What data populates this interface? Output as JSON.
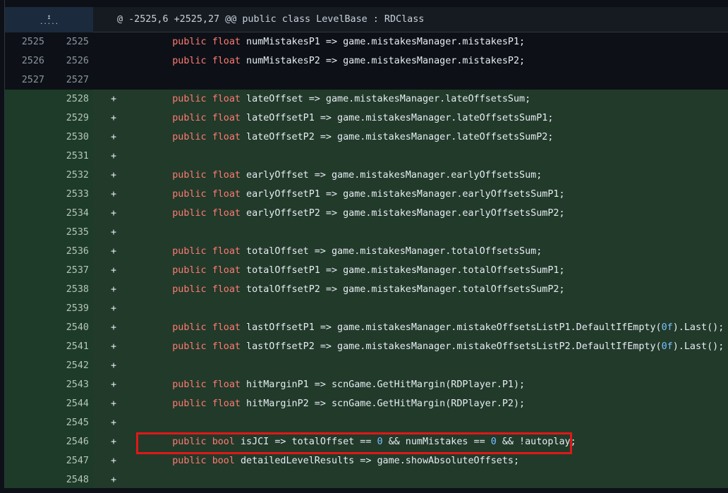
{
  "hunk": {
    "header": "@ -2525,6 +2525,27 @@ public class LevelBase : RDClass",
    "expand_icon": "expand-up-icon"
  },
  "lines": [
    {
      "type": "ctx",
      "old": "2525",
      "new": "2525",
      "marker": "",
      "tokens": [
        {
          "t": "    "
        },
        {
          "t": "public",
          "c": "kw"
        },
        {
          "t": " "
        },
        {
          "t": "float",
          "c": "kw"
        },
        {
          "t": " numMistakesP1 => game.mistakesManager.mistakesP1;"
        }
      ]
    },
    {
      "type": "ctx",
      "old": "2526",
      "new": "2526",
      "marker": "",
      "tokens": [
        {
          "t": "    "
        },
        {
          "t": "public",
          "c": "kw"
        },
        {
          "t": " "
        },
        {
          "t": "float",
          "c": "kw"
        },
        {
          "t": " numMistakesP2 => game.mistakesManager.mistakesP2;"
        }
      ]
    },
    {
      "type": "ctx",
      "old": "2527",
      "new": "2527",
      "marker": "",
      "tokens": []
    },
    {
      "type": "add",
      "old": "",
      "new": "2528",
      "marker": "+",
      "tokens": [
        {
          "t": "    "
        },
        {
          "t": "public",
          "c": "kw"
        },
        {
          "t": " "
        },
        {
          "t": "float",
          "c": "kw"
        },
        {
          "t": " lateOffset => game.mistakesManager.lateOffsetsSum;"
        }
      ]
    },
    {
      "type": "add",
      "old": "",
      "new": "2529",
      "marker": "+",
      "tokens": [
        {
          "t": "    "
        },
        {
          "t": "public",
          "c": "kw"
        },
        {
          "t": " "
        },
        {
          "t": "float",
          "c": "kw"
        },
        {
          "t": " lateOffsetP1 => game.mistakesManager.lateOffsetsSumP1;"
        }
      ]
    },
    {
      "type": "add",
      "old": "",
      "new": "2530",
      "marker": "+",
      "tokens": [
        {
          "t": "    "
        },
        {
          "t": "public",
          "c": "kw"
        },
        {
          "t": " "
        },
        {
          "t": "float",
          "c": "kw"
        },
        {
          "t": " lateOffsetP2 => game.mistakesManager.lateOffsetsSumP2;"
        }
      ]
    },
    {
      "type": "add",
      "old": "",
      "new": "2531",
      "marker": "+",
      "tokens": []
    },
    {
      "type": "add",
      "old": "",
      "new": "2532",
      "marker": "+",
      "tokens": [
        {
          "t": "    "
        },
        {
          "t": "public",
          "c": "kw"
        },
        {
          "t": " "
        },
        {
          "t": "float",
          "c": "kw"
        },
        {
          "t": " earlyOffset => game.mistakesManager.earlyOffsetsSum;"
        }
      ]
    },
    {
      "type": "add",
      "old": "",
      "new": "2533",
      "marker": "+",
      "tokens": [
        {
          "t": "    "
        },
        {
          "t": "public",
          "c": "kw"
        },
        {
          "t": " "
        },
        {
          "t": "float",
          "c": "kw"
        },
        {
          "t": " earlyOffsetP1 => game.mistakesManager.earlyOffsetsSumP1;"
        }
      ]
    },
    {
      "type": "add",
      "old": "",
      "new": "2534",
      "marker": "+",
      "tokens": [
        {
          "t": "    "
        },
        {
          "t": "public",
          "c": "kw"
        },
        {
          "t": " "
        },
        {
          "t": "float",
          "c": "kw"
        },
        {
          "t": " earlyOffsetP2 => game.mistakesManager.earlyOffsetsSumP2;"
        }
      ]
    },
    {
      "type": "add",
      "old": "",
      "new": "2535",
      "marker": "+",
      "tokens": []
    },
    {
      "type": "add",
      "old": "",
      "new": "2536",
      "marker": "+",
      "tokens": [
        {
          "t": "    "
        },
        {
          "t": "public",
          "c": "kw"
        },
        {
          "t": " "
        },
        {
          "t": "float",
          "c": "kw"
        },
        {
          "t": " totalOffset => game.mistakesManager.totalOffsetsSum;"
        }
      ]
    },
    {
      "type": "add",
      "old": "",
      "new": "2537",
      "marker": "+",
      "tokens": [
        {
          "t": "    "
        },
        {
          "t": "public",
          "c": "kw"
        },
        {
          "t": " "
        },
        {
          "t": "float",
          "c": "kw"
        },
        {
          "t": " totalOffsetP1 => game.mistakesManager.totalOffsetsSumP1;"
        }
      ]
    },
    {
      "type": "add",
      "old": "",
      "new": "2538",
      "marker": "+",
      "tokens": [
        {
          "t": "    "
        },
        {
          "t": "public",
          "c": "kw"
        },
        {
          "t": " "
        },
        {
          "t": "float",
          "c": "kw"
        },
        {
          "t": " totalOffsetP2 => game.mistakesManager.totalOffsetsSumP2;"
        }
      ]
    },
    {
      "type": "add",
      "old": "",
      "new": "2539",
      "marker": "+",
      "tokens": []
    },
    {
      "type": "add",
      "old": "",
      "new": "2540",
      "marker": "+",
      "tokens": [
        {
          "t": "    "
        },
        {
          "t": "public",
          "c": "kw"
        },
        {
          "t": " "
        },
        {
          "t": "float",
          "c": "kw"
        },
        {
          "t": " lastOffsetP1 => game.mistakesManager.mistakeOffsetsListP1.DefaultIfEmpty("
        },
        {
          "t": "0f",
          "c": "lit"
        },
        {
          "t": ").Last();"
        }
      ]
    },
    {
      "type": "add",
      "old": "",
      "new": "2541",
      "marker": "+",
      "tokens": [
        {
          "t": "    "
        },
        {
          "t": "public",
          "c": "kw"
        },
        {
          "t": " "
        },
        {
          "t": "float",
          "c": "kw"
        },
        {
          "t": " lastOffsetP2 => game.mistakesManager.mistakeOffsetsListP2.DefaultIfEmpty("
        },
        {
          "t": "0f",
          "c": "lit"
        },
        {
          "t": ").Last();"
        }
      ]
    },
    {
      "type": "add",
      "old": "",
      "new": "2542",
      "marker": "+",
      "tokens": []
    },
    {
      "type": "add",
      "old": "",
      "new": "2543",
      "marker": "+",
      "tokens": [
        {
          "t": "    "
        },
        {
          "t": "public",
          "c": "kw"
        },
        {
          "t": " "
        },
        {
          "t": "float",
          "c": "kw"
        },
        {
          "t": " hitMarginP1 => scnGame.GetHitMargin(RDPlayer.P1);"
        }
      ]
    },
    {
      "type": "add",
      "old": "",
      "new": "2544",
      "marker": "+",
      "tokens": [
        {
          "t": "    "
        },
        {
          "t": "public",
          "c": "kw"
        },
        {
          "t": " "
        },
        {
          "t": "float",
          "c": "kw"
        },
        {
          "t": " hitMarginP2 => scnGame.GetHitMargin(RDPlayer.P2);"
        }
      ]
    },
    {
      "type": "add",
      "old": "",
      "new": "2545",
      "marker": "+",
      "tokens": []
    },
    {
      "type": "add",
      "old": "",
      "new": "2546",
      "marker": "+",
      "tokens": [
        {
          "t": "    "
        },
        {
          "t": "public",
          "c": "kw"
        },
        {
          "t": " "
        },
        {
          "t": "bool",
          "c": "kw"
        },
        {
          "t": " isJCI => totalOffset == "
        },
        {
          "t": "0",
          "c": "lit"
        },
        {
          "t": " && numMistakes == "
        },
        {
          "t": "0",
          "c": "lit"
        },
        {
          "t": " && !autoplay;"
        }
      ]
    },
    {
      "type": "add",
      "old": "",
      "new": "2547",
      "marker": "+",
      "tokens": [
        {
          "t": "    "
        },
        {
          "t": "public",
          "c": "kw"
        },
        {
          "t": " "
        },
        {
          "t": "bool",
          "c": "kw"
        },
        {
          "t": " detailedLevelResults => game.showAbsoluteOffsets;"
        }
      ]
    },
    {
      "type": "add",
      "old": "",
      "new": "2548",
      "marker": "+",
      "tokens": []
    }
  ],
  "colors": {
    "keyword": "#ff7b72",
    "literal": "#79c0ff",
    "added_bg": "#223a2a",
    "highlight": "#e01818"
  }
}
